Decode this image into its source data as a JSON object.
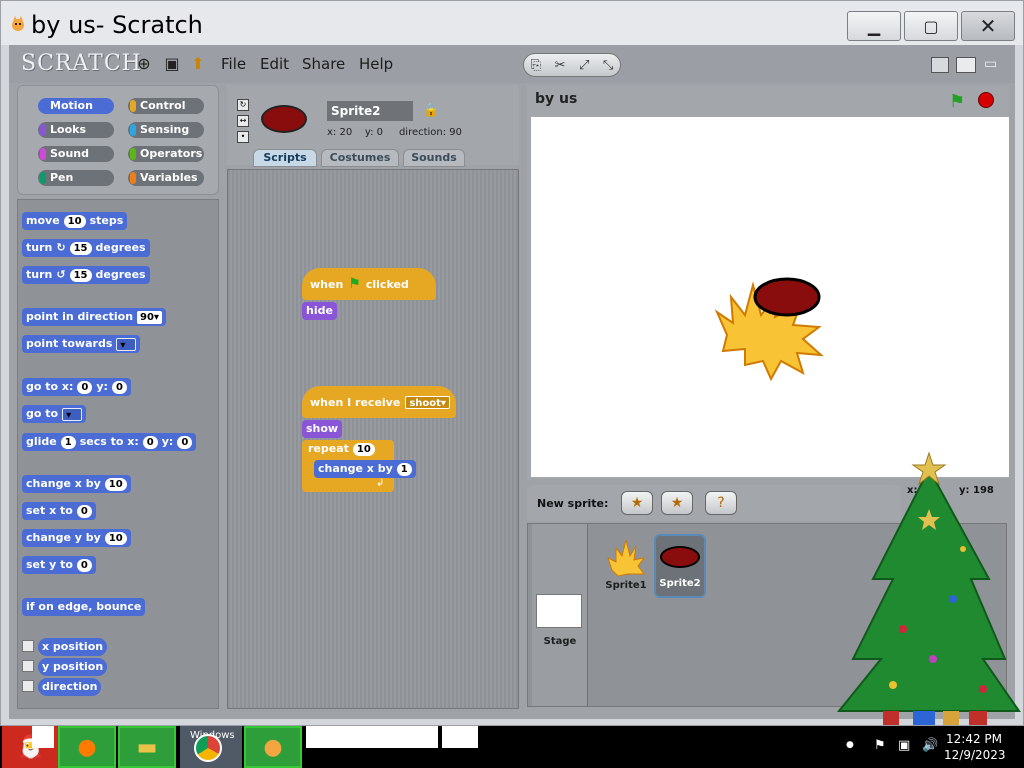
{
  "window": {
    "title": "by us- Scratch",
    "minimize_icon": "minimize-icon",
    "maximize_icon": "maximize-icon",
    "close_icon": "close-icon"
  },
  "menubar": {
    "logo": "SCRATCH",
    "items": [
      "File",
      "Edit",
      "Share",
      "Help"
    ]
  },
  "categories": [
    {
      "label": "Motion",
      "color": "#4a6cd4"
    },
    {
      "label": "Control",
      "color": "#e6a822"
    },
    {
      "label": "Looks",
      "color": "#8a55d7"
    },
    {
      "label": "Sensing",
      "color": "#2ca5e2"
    },
    {
      "label": "Sound",
      "color": "#cf4ad9"
    },
    {
      "label": "Operators",
      "color": "#5cb712"
    },
    {
      "label": "Pen",
      "color": "#0e9a6c"
    },
    {
      "label": "Variables",
      "color": "#ee7d16"
    }
  ],
  "palette": {
    "move": "move",
    "move_n": "10",
    "move_unit": "steps",
    "turn": "turn",
    "turn_n": "15",
    "degrees": "degrees",
    "point_dir": "point in direction",
    "point_dir_v": "90▾",
    "point_towards": "point towards",
    "goto_xy": "go to x:",
    "goto_x": "0",
    "y": "y:",
    "goto_y": "0",
    "goto": "go to",
    "glide": "glide",
    "glide_n": "1",
    "glide_secs": "secs to x:",
    "glide_x": "0",
    "glide_y": "0",
    "change_x": "change x by",
    "change_x_n": "10",
    "set_x": "set x to",
    "set_x_n": "0",
    "change_y": "change y by",
    "change_y_n": "10",
    "set_y": "set y to",
    "set_y_n": "0",
    "edge": "if on edge, bounce",
    "xpos": "x position",
    "ypos": "y position",
    "direction": "direction"
  },
  "sprite": {
    "name": "Sprite2",
    "x": "x: 20",
    "y": "y: 0",
    "direction": "direction: 90",
    "tabs": [
      "Scripts",
      "Costumes",
      "Sounds"
    ]
  },
  "scripts": {
    "when": "when",
    "clicked": "clicked",
    "hide": "hide",
    "when_receive": "when I receive",
    "msg": "shoot▾",
    "show": "show",
    "repeat": "repeat",
    "repeat_n": "10",
    "change_x": "change x by",
    "change_x_n": "1"
  },
  "stage": {
    "title": "by us",
    "mouse_x": "x:",
    "mouse_y": "y: 198"
  },
  "sprites_panel": {
    "new_sprite": "New sprite:",
    "stage_label": "Stage",
    "sprites": [
      "Sprite1",
      "Sprite2"
    ]
  },
  "taskbar": {
    "time": "12:42 PM",
    "date": "12/9/2023",
    "item_text": "Windows"
  }
}
